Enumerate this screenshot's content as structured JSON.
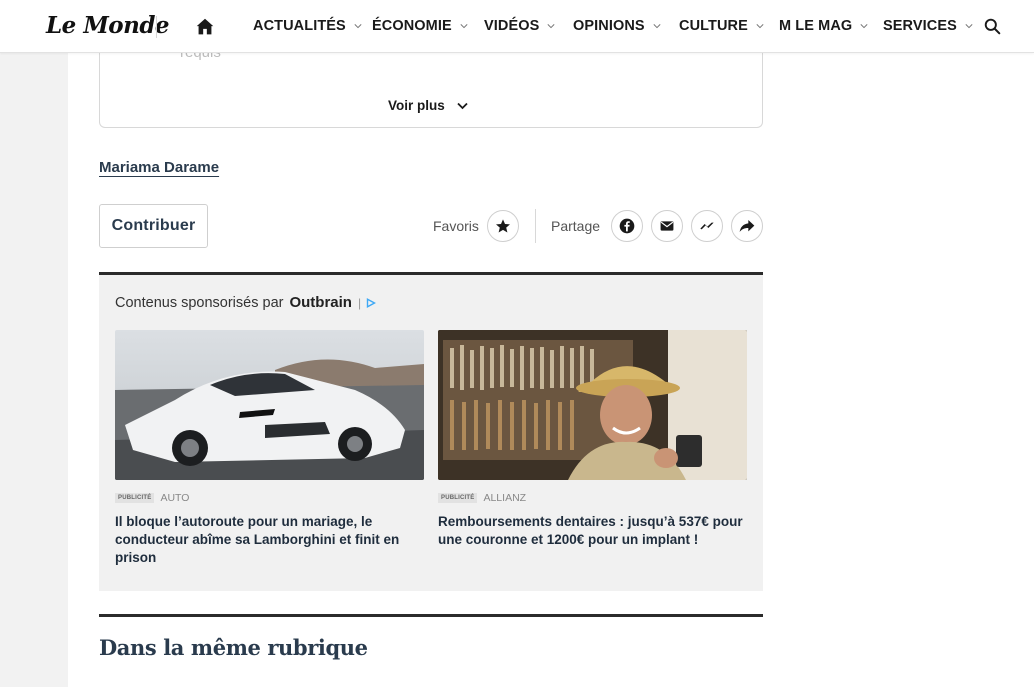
{
  "header": {
    "logo": "Le Monde",
    "nav": [
      "ACTUALITÉS",
      "ÉCONOMIE",
      "VIDÉOS",
      "OPINIONS",
      "CULTURE",
      "M LE MAG",
      "SERVICES"
    ]
  },
  "article": {
    "faded_text": "requis",
    "voir_plus": "Voir plus",
    "author": "Mariama Darame",
    "contribute": "Contribuer",
    "favorites_label": "Favoris",
    "share_label": "Partage"
  },
  "sponsored": {
    "label": "Contenus sponsorisés par",
    "brand": "Outbrain",
    "items": [
      {
        "badge": "PUBLICITÉ",
        "source": "AUTO",
        "title": "Il bloque l’autoroute pour un mariage, le conducteur abîme sa Lamborghini et finit en prison"
      },
      {
        "badge": "PUBLICITÉ",
        "source": "ALLIANZ",
        "title": "Remboursements dentaires : jusqu’à 537€ pour une couronne et 1200€ pour un implant !"
      }
    ]
  },
  "related": {
    "title": "Dans la même rubrique"
  },
  "colors": {
    "navy": "#2a3b4d",
    "outbrain_accent": "#3fa9f5"
  }
}
